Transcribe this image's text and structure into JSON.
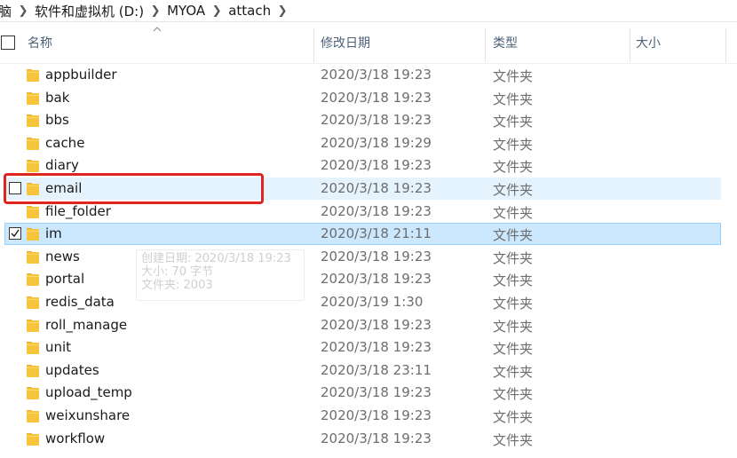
{
  "breadcrumb": {
    "partial": "脑",
    "items": [
      "软件和虚拟机 (D:)",
      "MYOA",
      "attach"
    ]
  },
  "columns": {
    "name": "名称",
    "date": "修改日期",
    "type": "类型",
    "size": "大小"
  },
  "files": [
    {
      "name": "appbuilder",
      "date": "2020/3/18 19:23",
      "type": "文件夹",
      "size": "",
      "state": "normal"
    },
    {
      "name": "bak",
      "date": "2020/3/18 19:23",
      "type": "文件夹",
      "size": "",
      "state": "normal"
    },
    {
      "name": "bbs",
      "date": "2020/3/18 19:23",
      "type": "文件夹",
      "size": "",
      "state": "normal"
    },
    {
      "name": "cache",
      "date": "2020/3/18 19:29",
      "type": "文件夹",
      "size": "",
      "state": "normal"
    },
    {
      "name": "diary",
      "date": "2020/3/18 19:23",
      "type": "文件夹",
      "size": "",
      "state": "normal"
    },
    {
      "name": "email",
      "date": "2020/3/18 19:23",
      "type": "文件夹",
      "size": "",
      "state": "hover"
    },
    {
      "name": "file_folder",
      "date": "2020/3/18 19:23",
      "type": "文件夹",
      "size": "",
      "state": "normal"
    },
    {
      "name": "im",
      "date": "2020/3/18 21:11",
      "type": "文件夹",
      "size": "",
      "state": "selected"
    },
    {
      "name": "news",
      "date": "2020/3/18 19:23",
      "type": "文件夹",
      "size": "",
      "state": "normal"
    },
    {
      "name": "portal",
      "date": "2020/3/18 19:23",
      "type": "文件夹",
      "size": "",
      "state": "normal"
    },
    {
      "name": "redis_data",
      "date": "2020/3/19 1:30",
      "type": "文件夹",
      "size": "",
      "state": "normal"
    },
    {
      "name": "roll_manage",
      "date": "2020/3/18 19:23",
      "type": "文件夹",
      "size": "",
      "state": "normal"
    },
    {
      "name": "unit",
      "date": "2020/3/18 19:23",
      "type": "文件夹",
      "size": "",
      "state": "normal"
    },
    {
      "name": "updates",
      "date": "2020/3/18 23:11",
      "type": "文件夹",
      "size": "",
      "state": "normal"
    },
    {
      "name": "upload_temp",
      "date": "2020/3/18 19:23",
      "type": "文件夹",
      "size": "",
      "state": "normal"
    },
    {
      "name": "weixunshare",
      "date": "2020/3/18 19:23",
      "type": "文件夹",
      "size": "",
      "state": "normal"
    },
    {
      "name": "workflow",
      "date": "2020/3/18 19:23",
      "type": "文件夹",
      "size": "",
      "state": "normal"
    }
  ],
  "tooltip": {
    "created": "创建日期: 2020/3/18 19:23",
    "size": "大小: 70 字节",
    "folders": "文件夹: 2003"
  },
  "icons": {
    "folder": "folder-icon",
    "sort": "sort-up-icon",
    "check": "checkmark-icon",
    "separator": "chevron-right-icon"
  },
  "colors": {
    "folder": "#f7c53b",
    "header_text": "#4c607a",
    "selected_bg": "#cce8ff",
    "selected_border": "#99d1ff",
    "hover_bg": "#e5f3ff",
    "annotation": "#e0241f"
  }
}
